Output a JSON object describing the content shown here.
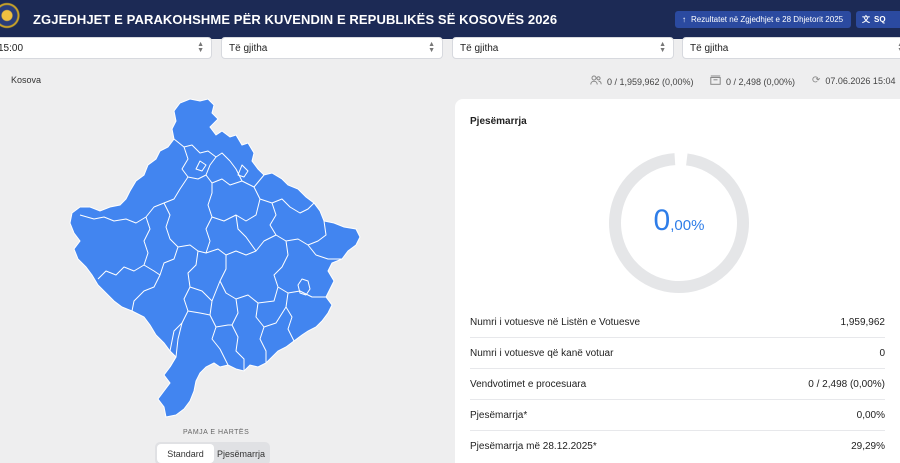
{
  "header": {
    "title": "ZGJEDHJET E PARAKOHSHME PËR KUVENDIN E REPUBLIKËS SË KOSOVËS 2026",
    "results_button": "Rezultatet në Zgjedhjet e 28 Dhjetorit 2025",
    "language": "SQ"
  },
  "filters": [
    {
      "value": "15:00"
    },
    {
      "value": "Të gjitha"
    },
    {
      "value": "Të gjitha"
    },
    {
      "value": "Të gjitha"
    }
  ],
  "info": {
    "region": "Kosova",
    "voters": "0 / 1,959,962 (0,00%)",
    "stations": "0 / 2,498 (0,00%)",
    "updated": "07.06.2026 15:04"
  },
  "map": {
    "caption": "PAMJA E HARTËS",
    "fill_color": "#4285f0",
    "view_options": [
      "Standard",
      "Pjesëmarrja"
    ],
    "selected_view": "Standard"
  },
  "participation": {
    "title": "Pjesëmarrja",
    "percent_int": "0",
    "percent_dec": ",00%",
    "percent_value": 0,
    "track_color": "#e5e6e8",
    "accent_color": "#2e7de8",
    "rows": [
      {
        "label": "Numri i votuesve në Listën e Votuesve",
        "value": "1,959,962"
      },
      {
        "label": "Numri i votuesve që kanë votuar",
        "value": "0"
      },
      {
        "label": "Vendvotimet e procesuara",
        "value": "0 / 2,498 (0,00%)"
      },
      {
        "label": "Pjesëmarrja*",
        "value": "0,00%"
      },
      {
        "label": "Pjesëmarrja më 28.12.2025*",
        "value": "29,29%"
      }
    ]
  }
}
